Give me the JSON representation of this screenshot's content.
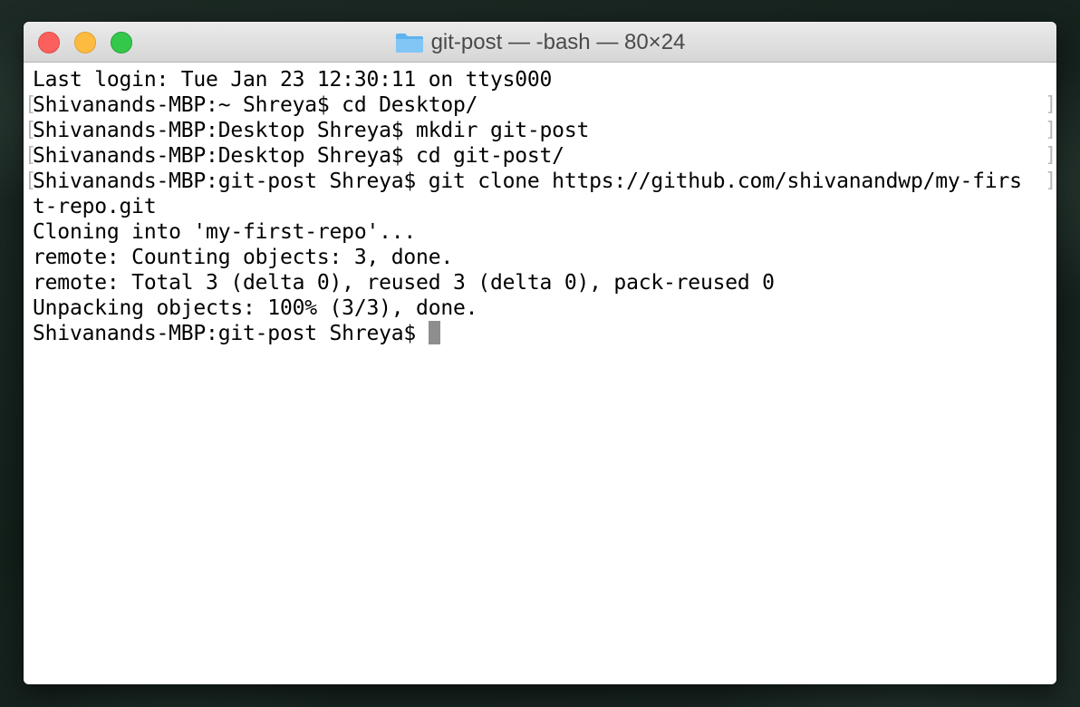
{
  "window": {
    "title": "git-post — -bash — 80×24",
    "folder_icon": "folder-icon",
    "controls": {
      "close": "close-icon",
      "minimize": "minimize-icon",
      "zoom": "zoom-icon"
    },
    "colors": {
      "close": "#fc605c",
      "minimize": "#fdbc40",
      "zoom": "#34c84a",
      "cursor": "#8e8e8e"
    }
  },
  "terminal": {
    "lines": [
      "Last login: Tue Jan 23 12:30:11 on ttys000",
      "Shivanands-MBP:~ Shreya$ cd Desktop/",
      "Shivanands-MBP:Desktop Shreya$ mkdir git-post",
      "Shivanands-MBP:Desktop Shreya$ cd git-post/",
      "Shivanands-MBP:git-post Shreya$ git clone https://github.com/shivanandwp/my-firs",
      "t-repo.git",
      "Cloning into 'my-first-repo'...",
      "remote: Counting objects: 3, done.",
      "remote: Total 3 (delta 0), reused 3 (delta 0), pack-reused 0",
      "Unpacking objects: 100% (3/3), done.",
      "Shivanands-MBP:git-post Shreya$ "
    ],
    "bracket_left": "[",
    "bracket_right": "]"
  }
}
